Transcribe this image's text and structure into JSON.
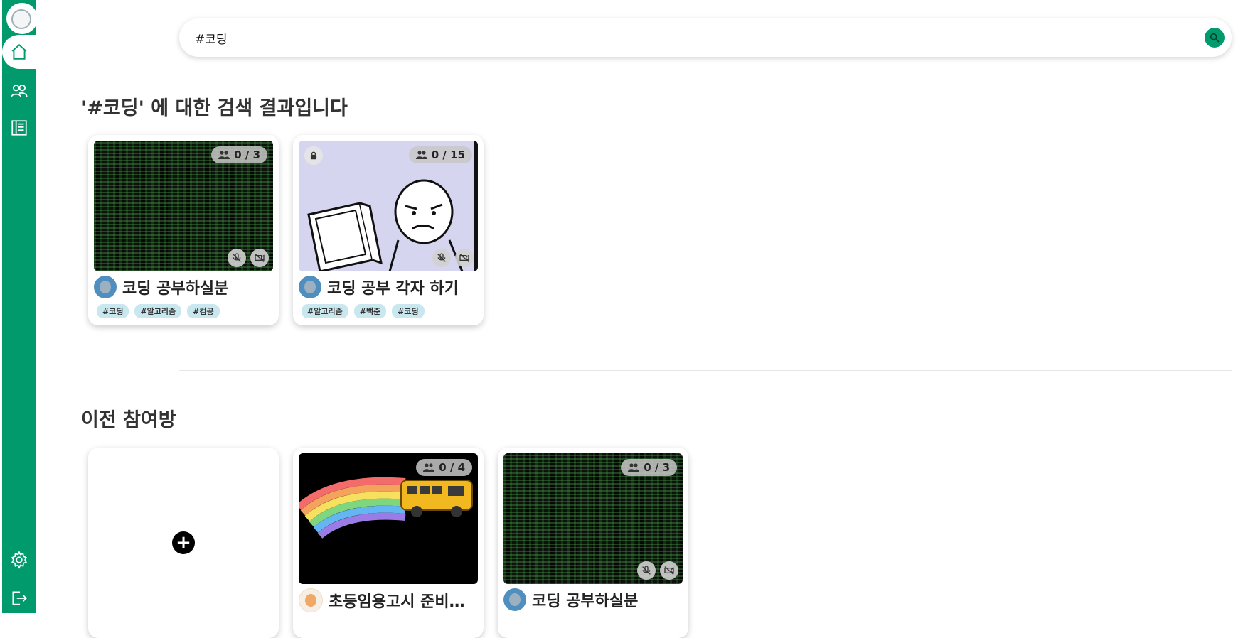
{
  "search": {
    "value": "#코딩"
  },
  "results_heading": "'#코딩' 에 대한 검색 결과입니다",
  "previous_heading": "이전 참여방",
  "results": [
    {
      "title": "코딩 공부하실분",
      "count": "0 / 3",
      "tags": [
        "#코딩",
        "#알고리즘",
        "#컴공"
      ]
    },
    {
      "title": "코딩 공부 각자 하기",
      "count": "0 / 15",
      "tags": [
        "#알고리즘",
        "#백준",
        "#코딩"
      ]
    }
  ],
  "previous": [
    {
      "title": "초등임용고시 준비…",
      "count": "0 / 4"
    },
    {
      "title": "코딩 공부하실분",
      "count": "0 / 3"
    }
  ],
  "add_label": "+",
  "colors": {
    "brand": "#009a6c",
    "tag_bg": "#c9e7ef"
  },
  "icons": {
    "sidebar": [
      "home-icon",
      "users-icon",
      "notebook-icon",
      "gear-icon",
      "logout-icon"
    ]
  }
}
